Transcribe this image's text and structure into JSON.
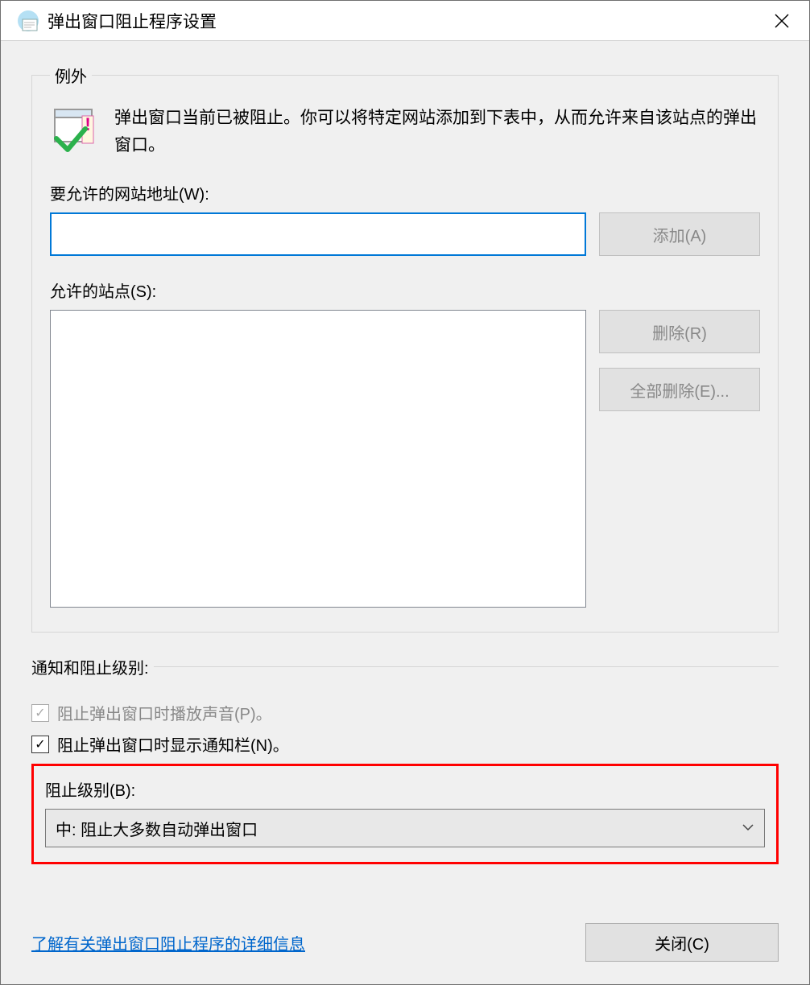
{
  "title": "弹出窗口阻止程序设置",
  "exceptions": {
    "legend": "例外",
    "info": "弹出窗口当前已被阻止。你可以将特定网站添加到下表中，从而允许来自该站点的弹出窗口。",
    "address_label": "要允许的网站地址(W):",
    "address_value": "",
    "add_button": "添加(A)",
    "allowed_label": "允许的站点(S):",
    "remove_button": "删除(R)",
    "remove_all_button": "全部删除(E)..."
  },
  "notifications": {
    "legend": "通知和阻止级别:",
    "play_sound": "阻止弹出窗口时播放声音(P)。",
    "play_sound_checked": true,
    "show_bar": "阻止弹出窗口时显示通知栏(N)。",
    "show_bar_checked": true,
    "level_label": "阻止级别(B):",
    "level_value": "中: 阻止大多数自动弹出窗口"
  },
  "footer": {
    "learn_more": "了解有关弹出窗口阻止程序的详细信息",
    "close_button": "关闭(C)"
  }
}
